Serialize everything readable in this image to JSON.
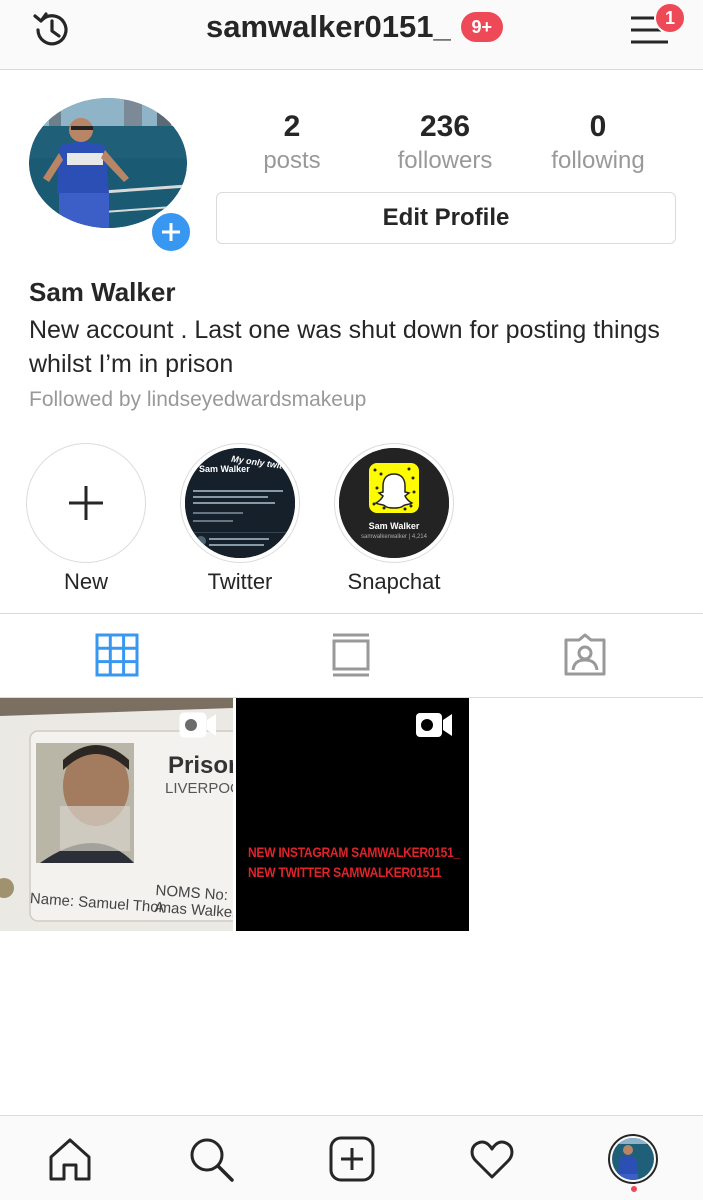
{
  "header": {
    "username": "samwalker0151_",
    "notification_badge": "9+",
    "menu_badge": "1"
  },
  "profile": {
    "stats": [
      {
        "value": "2",
        "label": "posts"
      },
      {
        "value": "236",
        "label": "followers"
      },
      {
        "value": "0",
        "label": "following"
      }
    ],
    "edit_button": "Edit Profile",
    "name": "Sam Walker",
    "bio": "New account . Last one was shut down for posting things whilst I’m in prison",
    "followed_by": "Followed by lindseyedwardsmakeup"
  },
  "highlights": [
    {
      "label": "New",
      "icon": "plus-icon"
    },
    {
      "label": "Twitter",
      "cover_title": "Sam Walker",
      "cover_caption": "My only twitter"
    },
    {
      "label": "Snapchat",
      "cover_title": "Sam Walker",
      "cover_subtitle": "samwalkerwalker | 4,214"
    }
  ],
  "tabs": [
    {
      "name": "grid",
      "icon": "grid-icon",
      "active": true
    },
    {
      "name": "feed",
      "icon": "feed-icon",
      "active": false
    },
    {
      "name": "tagged",
      "icon": "tagged-icon",
      "active": false
    }
  ],
  "posts": [
    {
      "type": "video",
      "card_title": "Prison",
      "card_location": "LIVERPOO",
      "card_noms": "NOMS No: A",
      "card_name": "Name: Samuel Thomas Walker"
    },
    {
      "type": "video",
      "line1": "NEW INSTAGRAM SAMWALKER0151_",
      "line2": "NEW TWITTER SAMWALKER01511"
    }
  ],
  "bottom_nav": [
    {
      "icon": "home-icon"
    },
    {
      "icon": "search-icon"
    },
    {
      "icon": "new-post-icon"
    },
    {
      "icon": "heart-icon"
    },
    {
      "icon": "profile-avatar-icon"
    }
  ],
  "colors": {
    "accent_blue": "#3897f0",
    "badge_red": "#ed4956",
    "post_text_red": "#e0222a",
    "muted_text": "#999999",
    "border": "#dbdbdb"
  }
}
